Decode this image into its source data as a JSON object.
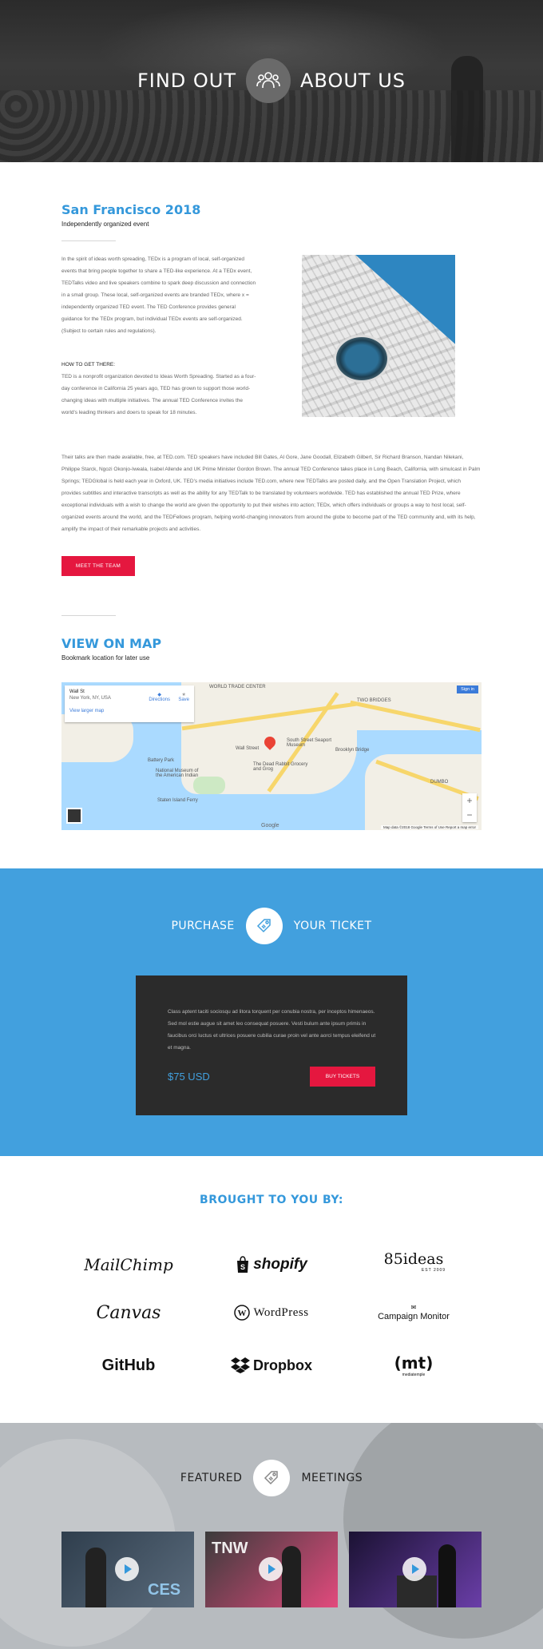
{
  "hero": {
    "left_word": "FIND OUT",
    "right_word": "ABOUT US",
    "icon": "people-group-icon"
  },
  "about": {
    "title": "San Francisco 2018",
    "subtitle": "Independently organized event",
    "intro": "In the spirit of ideas worth spreading, TEDx is a program of local, self-organized events that bring people together to share a TED-like experience. At a TEDx event, TEDTalks video and live speakers combine to spark deep discussion and connection in a small group. These local, self-organized events are branded TEDx, where x = independently organized TED event. The TED Conference provides general guidance for the TEDx program, but individual TEDx events are self-organized. (Subject to certain rules and regulations).",
    "how_heading": "HOW TO GET THERE:",
    "how_text": "TED is a nonprofit organization devoted to Ideas Worth Spreading. Started as a four-day conference in California 25 years ago, TED has grown to support those world-changing ideas with multiple initiatives. The annual TED Conference invites the world's leading thinkers and doers to speak for 18 minutes.",
    "long_text": "Their talks are then made available, free, at TED.com. TED speakers have included Bill Gates, Al Gore, Jane Goodall, Elizabeth Gilbert, Sir Richard Branson, Nandan Nilekani, Philippe Starck, Ngozi Okonjo-Iweala, Isabel Allende and UK Prime Minister Gordon Brown. The annual TED Conference takes place in Long Beach, California, with simulcast in Palm Springs; TEDGlobal is held each year in Oxford, UK. TED's media initiatives include TED.com, where new TEDTalks are posted daily, and the Open Translation Project, which provides subtitles and interactive transcripts as well as the ability for any TEDTalk to be translated by volunteers worldwide. TED has established the annual TED Prize, where exceptional individuals with a wish to change the world are given the opportunity to put their wishes into action; TEDx, which offers individuals or groups a way to host local, self-organized events around the world, and the TEDFellows program, helping world-changing innovators from around the globe to become part of the TED community and, with its help, amplify the impact of their remarkable projects and activities.",
    "button": "MEET THE TEAM"
  },
  "map": {
    "title": "VIEW ON MAP",
    "subtitle": "Bookmark location for later use",
    "card_title": "Wall St",
    "card_address": "New York, NY, USA",
    "card_link": "View larger map",
    "directions": "Directions",
    "save": "Save",
    "signin": "Sign in",
    "labels": [
      "WORLD TRADE CENTER",
      "TWO BRIDGES",
      "DUMBO",
      "Wall Street",
      "South Street Seaport Museum",
      "Brooklyn Bridge",
      "The Dead Rabbit Grocery and Grog",
      "National Museum of the American Indian",
      "Battery Park",
      "Staten Island Ferry"
    ],
    "footer": "Map data ©2018 Google   Terms of Use   Report a map error",
    "google": "Google"
  },
  "purchase": {
    "left_word": "PURCHASE",
    "right_word": "YOUR TICKET",
    "icon": "ticket-tag-icon",
    "text": "Class aptent taciti sociosqu ad litora torquent per conubia nostra, per inceptos himenaeos. Sed mol estie augue sit amet leo consequat posuere. Vesti bulum ante ipsum primis in faucibus orci luctus et ultrices posuere cubilia curae proin vel ante aorci tempus eleifend ut et magna.",
    "price": "$75 USD",
    "button": "BUY TICKETS"
  },
  "sponsors": {
    "title": "BROUGHT TO YOU BY:",
    "logos": [
      "MailChimp",
      "shopify",
      "85ideas",
      "Canvas",
      "WordPress",
      "Campaign Monitor",
      "GitHub",
      "Dropbox",
      "mediatemple"
    ],
    "ideas_sub": "EST 2009"
  },
  "featured": {
    "left_word": "FEATURED",
    "right_word": "MEETINGS",
    "icon": "ticket-tag-icon",
    "videos": [
      {
        "tag": "CES",
        "bg": "#2f3e4d"
      },
      {
        "tag": "TNW",
        "bg": "#e24a7d"
      },
      {
        "tag": "",
        "bg": "#3a2a5a"
      }
    ]
  },
  "colors": {
    "accent_blue": "#3498db",
    "purchase_bg": "#42a0de",
    "red": "#e5173f",
    "dark": "#2b2b2b"
  }
}
